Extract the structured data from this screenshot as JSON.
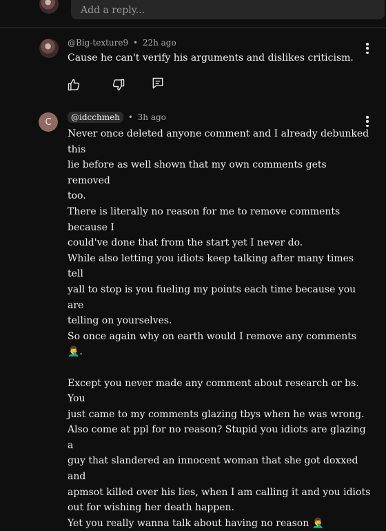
{
  "reply_box": {
    "placeholder": "Add a reply...",
    "avatar_icon": "user-photo-avatar"
  },
  "comments": [
    {
      "author": "@Big-texture9",
      "separator": "•",
      "time": "22h ago",
      "avatar_icon": "user-photo-avatar",
      "lines": [
        "Cause he can't verify his arguments and dislikes criticism."
      ],
      "actions": {
        "like_icon": "thumbs-up-icon",
        "dislike_icon": "thumbs-down-icon",
        "reply_icon": "reply-comment-icon"
      },
      "menu_icon": "more-vert-icon"
    },
    {
      "author": "@idcchmeh",
      "separator": "•",
      "time": "3h ago",
      "avatar_letter": "C",
      "avatar_color": "#8f6a63",
      "menu_icon": "more-vert-icon",
      "lines": [
        "Never once deleted anyone comment and I already debunked this",
        "lie before as well shown that my own comments gets removed",
        "too.",
        "There is literally no reason for me to remove comments because I",
        "could've done that from the start yet I never do.",
        "While also letting you idiots keep talking after many times tell",
        "yall to stop is you fueling my points each time because you are",
        "telling on yourselves.",
        "So once again why on earth would I remove any comments 🤦‍♂️.",
        "",
        "Except you never made any comment about research or bs. You",
        "just came to my comments glazing tbys when he was wrong.",
        "Also come at ppl for no reason? Stupid you idiots are glazing a",
        "guy that slandered an innocent woman that she got doxxed and",
        "apmsot killed over his lies, when I am calling it and you idiots",
        "out for wishing her death happen.",
        "Yet you really wanna talk about having no reason 🤦‍♂️"
      ]
    }
  ]
}
